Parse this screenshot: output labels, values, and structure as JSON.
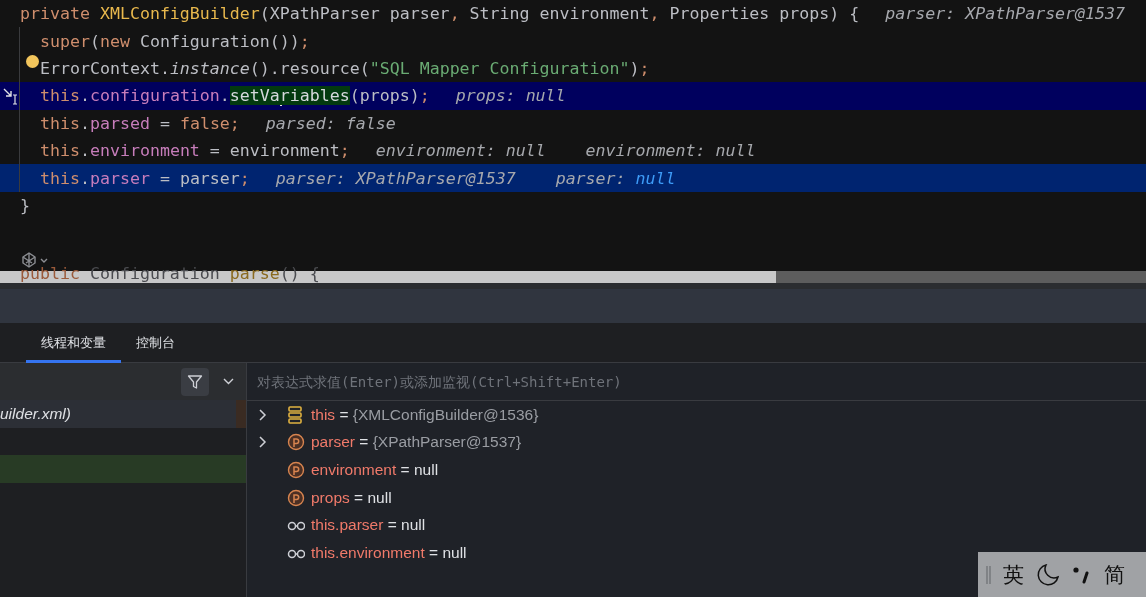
{
  "editor": {
    "method": {
      "header": {
        "tokens": [
          {
            "t": "private ",
            "kind": "kw"
          },
          {
            "t": "XMLConfigBuilder",
            "kind": "decl"
          },
          {
            "t": "(XPathParser parser",
            "kind": "plain"
          },
          {
            "t": ",",
            "kind": "punct"
          },
          {
            "t": " String environment",
            "kind": "plain"
          },
          {
            "t": ",",
            "kind": "punct"
          },
          {
            "t": " Properties props) {",
            "kind": "plain"
          }
        ],
        "execution": false,
        "selected": false,
        "hints": [
          {
            "label": "parser:",
            "value": "XPathParser@1537",
            "changed": false
          }
        ]
      },
      "body": [
        {
          "tokens": [
            {
              "t": "super",
              "kind": "kw"
            },
            {
              "t": "(",
              "kind": "plain"
            },
            {
              "t": "new ",
              "kind": "kw"
            },
            {
              "t": "Configuration())",
              "kind": "plain"
            },
            {
              "t": ";",
              "kind": "punct"
            }
          ],
          "execution": false,
          "selected": false
        },
        {
          "tokens": [
            {
              "t": "ErrorContext.",
              "kind": "plain"
            },
            {
              "t": "instance",
              "kind": "ital"
            },
            {
              "t": "().resource(",
              "kind": "plain"
            },
            {
              "t": "\"SQL Mapper Configuration\"",
              "kind": "str"
            },
            {
              "t": ")",
              "kind": "plain"
            },
            {
              "t": ";",
              "kind": "punct"
            }
          ],
          "execution": false,
          "selected": false,
          "intention": true
        },
        {
          "tokens": [
            {
              "t": "this",
              "kind": "kw"
            },
            {
              "t": ".",
              "kind": "plain"
            },
            {
              "t": "configuration",
              "kind": "field"
            },
            {
              "t": ".",
              "kind": "plain"
            },
            {
              "t": "setVa",
              "kind": "match",
              "caret_after": true
            },
            {
              "t": "riables",
              "kind": "match"
            },
            {
              "t": "(props)",
              "kind": "plain"
            },
            {
              "t": ";",
              "kind": "punct"
            }
          ],
          "execution": true,
          "selected": false,
          "hints": [
            {
              "label": "props:",
              "value": "null",
              "changed": false
            }
          ]
        },
        {
          "tokens": [
            {
              "t": "this",
              "kind": "kw"
            },
            {
              "t": ".",
              "kind": "plain"
            },
            {
              "t": "parsed",
              "kind": "field"
            },
            {
              "t": " = ",
              "kind": "plain"
            },
            {
              "t": "false",
              "kind": "kw"
            },
            {
              "t": ";",
              "kind": "punct"
            }
          ],
          "execution": false,
          "selected": false,
          "hints": [
            {
              "label": "parsed:",
              "value": "false",
              "changed": false
            }
          ]
        },
        {
          "tokens": [
            {
              "t": "this",
              "kind": "kw"
            },
            {
              "t": ".",
              "kind": "plain"
            },
            {
              "t": "environment",
              "kind": "field"
            },
            {
              "t": " = environment",
              "kind": "plain"
            },
            {
              "t": ";",
              "kind": "punct"
            }
          ],
          "execution": false,
          "selected": false,
          "hints": [
            {
              "label": "environment:",
              "value": "null",
              "changed": false
            },
            {
              "label": "environment:",
              "value": "null",
              "changed": false
            }
          ]
        },
        {
          "tokens": [
            {
              "t": "this",
              "kind": "kw"
            },
            {
              "t": ".",
              "kind": "plain"
            },
            {
              "t": "parser",
              "kind": "field"
            },
            {
              "t": " = parser",
              "kind": "plain"
            },
            {
              "t": ";",
              "kind": "punct"
            }
          ],
          "execution": false,
          "selected": true,
          "hints": [
            {
              "label": "parser:",
              "value": "XPathParser@1537",
              "changed": false
            },
            {
              "label": "parser:",
              "value": "null",
              "changed": true
            }
          ]
        }
      ],
      "end": {
        "tokens": [
          {
            "t": "}",
            "kind": "plain"
          }
        ],
        "execution": false,
        "selected": false
      }
    },
    "next_method": {
      "header": {
        "tokens": [
          {
            "t": "public ",
            "kind": "kw"
          },
          {
            "t": "Configuration ",
            "kind": "plain"
          },
          {
            "t": "parse",
            "kind": "decl"
          },
          {
            "t": "() {",
            "kind": "plain"
          }
        ],
        "execution": false,
        "selected": false
      }
    }
  },
  "debug_panel": {
    "tabs": [
      {
        "label": "线程和变量",
        "selected": true
      },
      {
        "label": "控制台",
        "selected": false
      }
    ],
    "frames": [
      {
        "label": "uilder.xml)",
        "selected": true,
        "highlighted": false
      },
      {
        "selected": false,
        "highlighted": true
      }
    ],
    "evaluate_field": {
      "placeholder": "对表达式求值(Enter)或添加监视(Ctrl+Shift+Enter)"
    },
    "variables": [
      {
        "kind": "this",
        "name": "this",
        "op": "=",
        "value": "{XMLConfigBuilder@1536}",
        "expandable": true
      },
      {
        "kind": "param",
        "name": "parser",
        "op": "=",
        "value": "{XPathParser@1537}",
        "expandable": true
      },
      {
        "kind": "param",
        "name": "environment",
        "op": "=",
        "value": "null",
        "expandable": false
      },
      {
        "kind": "param",
        "name": "props",
        "op": "=",
        "value": "null",
        "expandable": false
      },
      {
        "kind": "watch",
        "name": "this.parser",
        "op": "=",
        "value": "null",
        "expandable": false
      },
      {
        "kind": "watch",
        "name": "this.environment",
        "op": "=",
        "value": "null",
        "expandable": false
      }
    ]
  },
  "ime_toolbar": {
    "mode": "英",
    "script": "简"
  }
}
